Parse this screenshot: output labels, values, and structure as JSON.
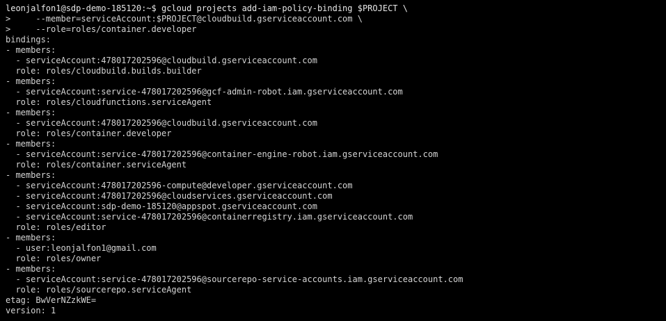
{
  "terminal": {
    "background": "#000000",
    "foreground": "#d4d4d4",
    "prompt": "leonjalfon1@sdp-demo-185120:~$",
    "command": " gcloud projects add-iam-policy-binding $PROJECT \\",
    "continuation_1": ">     --member=serviceAccount:$PROJECT@cloudbuild.gserviceaccount.com \\",
    "continuation_2": ">     --role=roles/container.developer",
    "output": [
      "bindings:",
      "- members:",
      "  - serviceAccount:478017202596@cloudbuild.gserviceaccount.com",
      "  role: roles/cloudbuild.builds.builder",
      "- members:",
      "  - serviceAccount:service-478017202596@gcf-admin-robot.iam.gserviceaccount.com",
      "  role: roles/cloudfunctions.serviceAgent",
      "- members:",
      "  - serviceAccount:478017202596@cloudbuild.gserviceaccount.com",
      "  role: roles/container.developer",
      "- members:",
      "  - serviceAccount:service-478017202596@container-engine-robot.iam.gserviceaccount.com",
      "  role: roles/container.serviceAgent",
      "- members:",
      "  - serviceAccount:478017202596-compute@developer.gserviceaccount.com",
      "  - serviceAccount:478017202596@cloudservices.gserviceaccount.com",
      "  - serviceAccount:sdp-demo-185120@appspot.gserviceaccount.com",
      "  - serviceAccount:service-478017202596@containerregistry.iam.gserviceaccount.com",
      "  role: roles/editor",
      "- members:",
      "  - user:leonjalfon1@gmail.com",
      "  role: roles/owner",
      "- members:",
      "  - serviceAccount:service-478017202596@sourcerepo-service-accounts.iam.gserviceaccount.com",
      "  role: roles/sourcerepo.serviceAgent",
      "etag: BwVerNZzkWE=",
      "version: 1"
    ]
  }
}
